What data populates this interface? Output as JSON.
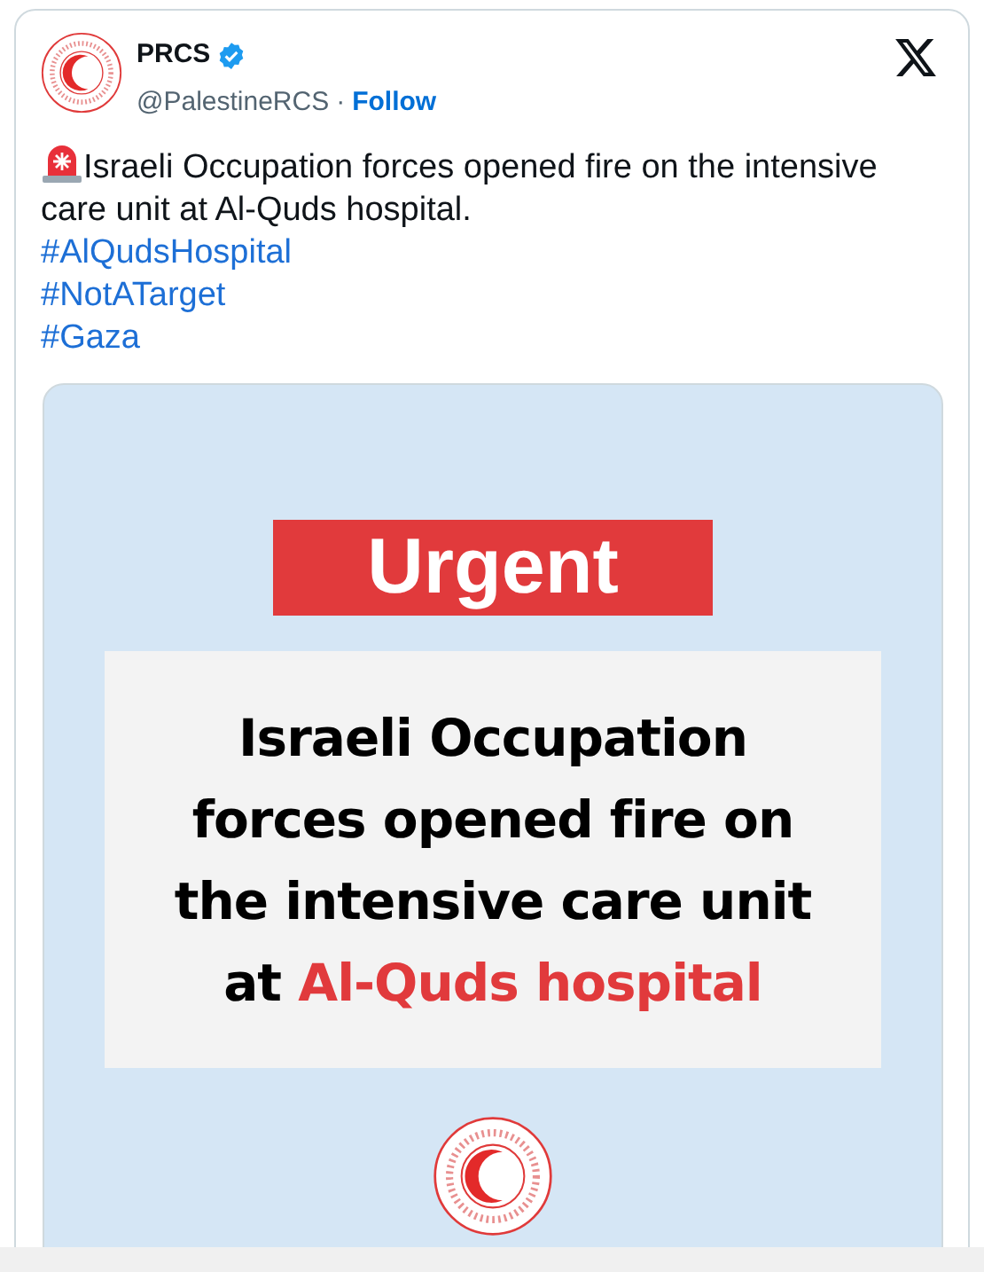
{
  "author": {
    "name": "PRCS",
    "verified": true,
    "handle": "@PalestineRCS",
    "separator": "·",
    "follow": "Follow"
  },
  "tweet": {
    "text": "Israeli Occupation forces opened fire on the intensive care unit at Al-Quds hospital.",
    "hashtags": [
      "#AlQudsHospital",
      "#NotATarget",
      "#Gaza"
    ]
  },
  "media": {
    "banner": "Urgent",
    "headline": [
      "Israeli Occupation",
      "forces opened fire on",
      "the intensive care unit"
    ],
    "last_line": "at ",
    "highlight": "Al-Quds hospital"
  }
}
